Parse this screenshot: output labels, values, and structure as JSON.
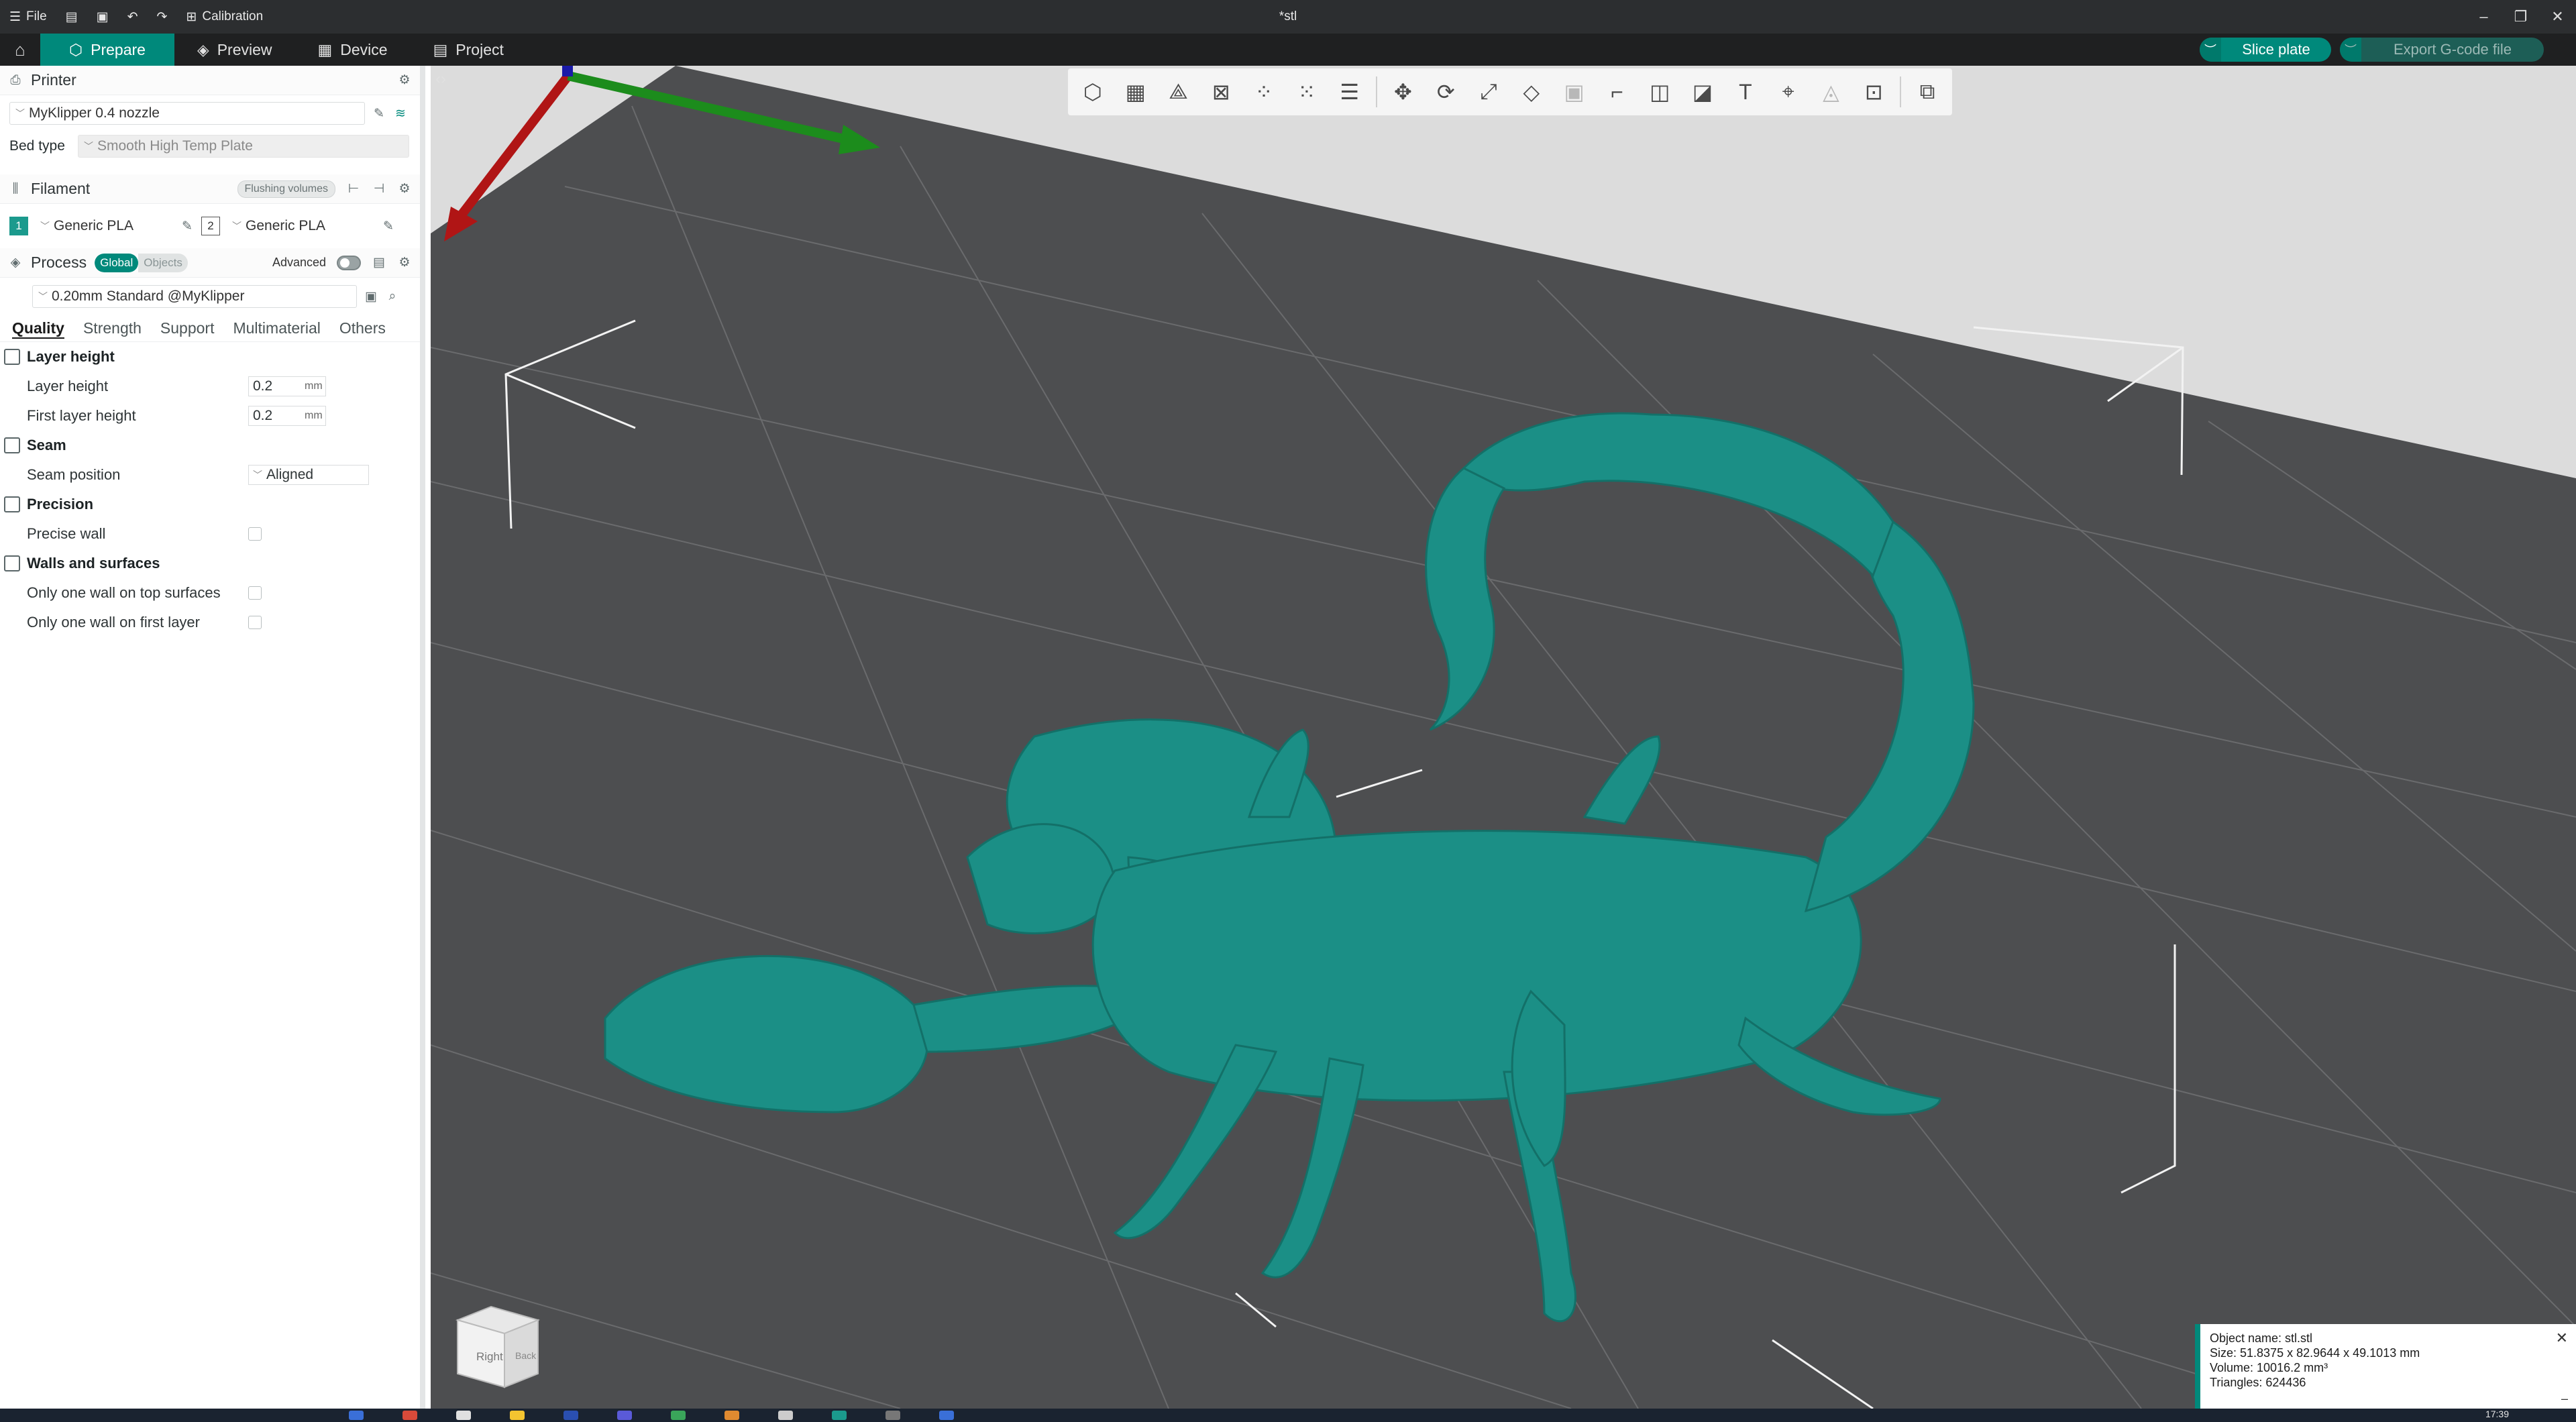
{
  "titlebar": {
    "menu_file": "File",
    "calibration": "Calibration",
    "doc_title": "*stl"
  },
  "tabs": {
    "prepare": "Prepare",
    "preview": "Preview",
    "device": "Device",
    "project": "Project"
  },
  "actions": {
    "slice": "Slice plate",
    "export": "Export G-code file"
  },
  "printer": {
    "section": "Printer",
    "name": "MyKlipper 0.4 nozzle",
    "bed_label": "Bed type",
    "bed_value": "Smooth High Temp Plate"
  },
  "filament": {
    "section": "Filament",
    "flushing": "Flushing volumes",
    "slots": [
      {
        "num": "1",
        "name": "Generic PLA",
        "color": "#1b9a8d"
      },
      {
        "num": "2",
        "name": "Generic PLA",
        "color": "#ffffff"
      }
    ]
  },
  "process": {
    "section": "Process",
    "global": "Global",
    "objects": "Objects",
    "advanced": "Advanced",
    "preset": "0.20mm Standard @MyKlipper"
  },
  "subtabs": [
    "Quality",
    "Strength",
    "Support",
    "Multimaterial",
    "Others"
  ],
  "settings": {
    "layer_group": "Layer height",
    "layer_height_label": "Layer height",
    "layer_height_value": "0.2",
    "first_layer_label": "First layer height",
    "first_layer_value": "0.2",
    "unit_mm": "mm",
    "seam_group": "Seam",
    "seam_pos_label": "Seam position",
    "seam_pos_value": "Aligned",
    "precision_group": "Precision",
    "precise_wall_label": "Precise wall",
    "walls_group": "Walls and surfaces",
    "one_wall_top_label": "Only one wall on top surfaces",
    "one_wall_first_label": "Only one wall on first layer"
  },
  "viewcube": {
    "right": "Right",
    "back": "Back"
  },
  "object_info": {
    "name": "Object name: stl.stl",
    "size": "Size: 51.8375 x 82.9644 x 49.1013 mm",
    "volume": "Volume: 10016.2 mm³",
    "triangles": "Triangles: 624436"
  },
  "taskbar": {
    "time": "17:39"
  },
  "colors": {
    "accent": "#00897b",
    "model": "#1b8f86",
    "plate": "#4d4e50"
  }
}
